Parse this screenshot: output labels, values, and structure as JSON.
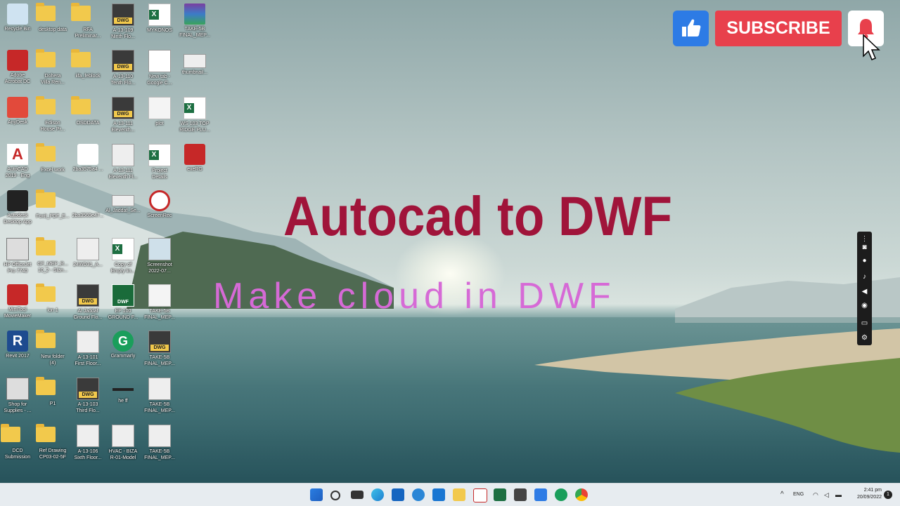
{
  "title": "Autocad to DWF",
  "subtitle": "Make cloud in DWF",
  "youtube": {
    "subscribe_label": "SUBSCRIBE"
  },
  "desktop_icons": [
    {
      "label": "Recycle Bin",
      "type": "recycle"
    },
    {
      "label": "Autodesk\nDesktop App",
      "type": "ada"
    },
    {
      "label": "HP OfficeJet\nPro 7740",
      "type": "printer"
    },
    {
      "label": "Revit 2017",
      "type": "revit"
    },
    {
      "label": "Shop for\nSupplies - ...",
      "type": "printer"
    },
    {
      "label": "DCD\nSubmission",
      "type": "folder"
    },
    {
      "label": "Foxit_PDF_E...",
      "type": "folder"
    },
    {
      "label": "lon 1",
      "type": "folder"
    },
    {
      "label": "New folder\n(4)",
      "type": "folder"
    },
    {
      "label": "P1",
      "type": "folder"
    },
    {
      "label": "Ref Drawing\nCP03-02-5F",
      "type": "folder"
    },
    {
      "label": "Al Jaddaf\nGround Flo...",
      "type": "dwg"
    },
    {
      "label": "A-13-101\nFirst Floor...",
      "type": "thumb"
    },
    {
      "label": "A-13-103\nThird Flo...",
      "type": "dwg"
    },
    {
      "label": "A-13-106\nSixth Floor...",
      "type": "thumb"
    },
    {
      "label": "EP 100\nGROUND F...",
      "type": "dwf"
    },
    {
      "label": "Grammarly",
      "type": "grammarly"
    },
    {
      "label": "he ff",
      "type": "thumb"
    },
    {
      "label": "HVAC - BIZA\nR-01-Model",
      "type": "thumb"
    },
    {
      "label": "TAKE-5B\nFINAL_MEP...",
      "type": "doc"
    },
    {
      "label": "TAKE-5B\nFINAL_MEP...",
      "type": "dwg"
    },
    {
      "label": "TAKE-5B\nFINAL_MEP...",
      "type": "thumb"
    },
    {
      "label": "TAKE-5B\nFINAL_MEP...",
      "type": "thumb"
    }
  ],
  "taskbar": {
    "lang": "ENG",
    "time": "2:41 pm",
    "date": "20/09/2022"
  }
}
